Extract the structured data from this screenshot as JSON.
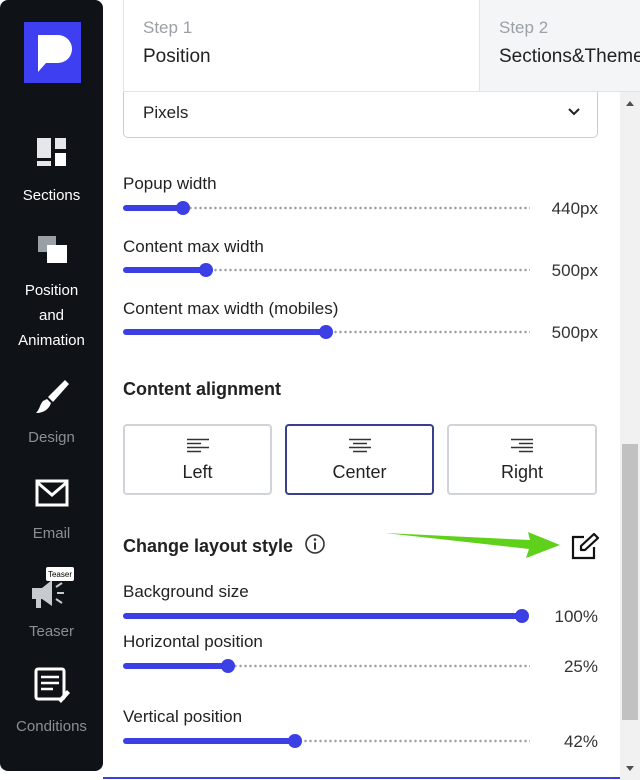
{
  "sidebar": {
    "items": [
      {
        "label": "Sections",
        "icon": "sections-icon",
        "active": true
      },
      {
        "label": "Position and Animation",
        "icon": "position-icon",
        "active": true
      },
      {
        "label": "Design",
        "icon": "brush-icon",
        "active": false
      },
      {
        "label": "Email",
        "icon": "envelope-icon",
        "active": false
      },
      {
        "label": "Teaser",
        "icon": "megaphone-icon",
        "badge": "Teaser",
        "active": false
      },
      {
        "label": "Conditions",
        "icon": "checklist-icon",
        "active": false
      }
    ],
    "position_lines": [
      "Position",
      "and",
      "Animation"
    ]
  },
  "tabs": [
    {
      "step": "Step 1",
      "name": "Position"
    },
    {
      "step": "Step 2",
      "name": "Sections&Themes"
    }
  ],
  "unit_select": {
    "value": "Pixels"
  },
  "sliders": [
    {
      "label": "Popup width",
      "value_text": "440px",
      "fraction": 0.147
    },
    {
      "label": "Content max width",
      "value_text": "500px",
      "fraction": 0.204
    },
    {
      "label": "Content max width (mobiles)",
      "value_text": "500px",
      "fraction": 0.499
    }
  ],
  "content_alignment": {
    "heading": "Content alignment",
    "options": [
      "Left",
      "Center",
      "Right"
    ],
    "selected": "Center"
  },
  "layout": {
    "heading": "Change layout style",
    "sliders": [
      {
        "label": "Background size",
        "value_text": "100%",
        "fraction": 1.0
      },
      {
        "label": "Horizontal position",
        "value_text": "25%",
        "fraction": 0.258
      },
      {
        "label": "Vertical position",
        "value_text": "42%",
        "fraction": 0.422
      }
    ]
  },
  "colors": {
    "accent": "#3b3fe4",
    "sidebar_bg": "#0f1318",
    "arrow": "#5fd11a",
    "selected_border": "#3a3e8e"
  }
}
